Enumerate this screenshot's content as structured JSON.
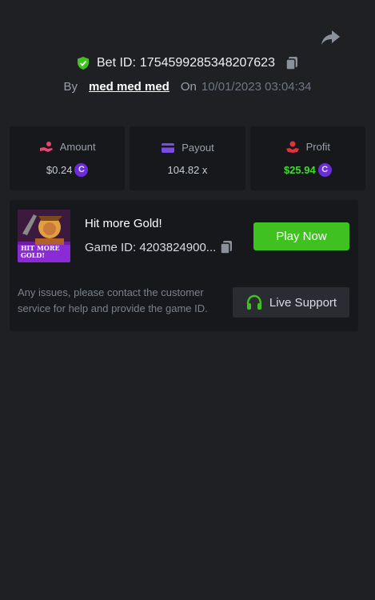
{
  "header": {
    "bet_label": "Bet ID:",
    "bet_id": "1754599285348207623",
    "by_label": "By",
    "username": "med med med",
    "on_label": "On",
    "timestamp": "10/01/2023 03:04:34"
  },
  "stats": {
    "amount": {
      "label": "Amount",
      "value": "$0.24",
      "icon": "hand-coins-icon"
    },
    "payout": {
      "label": "Payout",
      "value": "104.82 x",
      "icon": "card-icon"
    },
    "profit": {
      "label": "Profit",
      "value": "$25.94",
      "icon": "hand-money-icon"
    }
  },
  "coin_symbol": "C",
  "game": {
    "title": "Hit more Gold!",
    "id_label": "Game ID:",
    "id_value": "4203824900...",
    "play_label": "Play Now",
    "thumb_text_line1": "HIT MORE",
    "thumb_text_line2": "GOLD!"
  },
  "support": {
    "help_text": "Any issues, please contact the customer service for help and provide the game ID.",
    "button_label": "Live Support"
  },
  "colors": {
    "background": "#1f2024",
    "card": "#17181b",
    "accent_green": "#3fc21f",
    "profit_green": "#3fdc30",
    "coin_purple": "#6a2dd6",
    "amount_pink": "#e8456f",
    "payout_purple": "#7b4be6",
    "profit_red": "#e2313c"
  }
}
